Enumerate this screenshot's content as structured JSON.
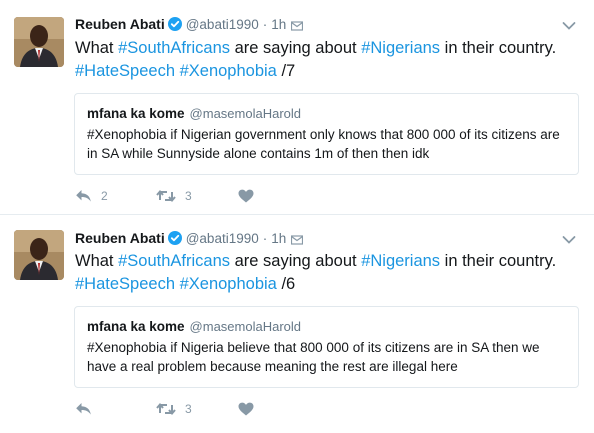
{
  "tweets": [
    {
      "author_name": "Reuben Abati",
      "handle": "@abati1990",
      "separator": "·",
      "time": "1h",
      "text_parts": [
        {
          "text": "What ",
          "hashtag": false
        },
        {
          "text": "#SouthAfricans",
          "hashtag": true
        },
        {
          "text": " are saying about ",
          "hashtag": false
        },
        {
          "text": "#Nigerians",
          "hashtag": true
        },
        {
          "text": " in their country. ",
          "hashtag": false
        },
        {
          "text": "#HateSpeech",
          "hashtag": true
        },
        {
          "text": " ",
          "hashtag": false
        },
        {
          "text": "#Xenophobia",
          "hashtag": true
        },
        {
          "text": " /7",
          "hashtag": false
        }
      ],
      "quote": {
        "author_name": "mfana ka kome",
        "handle": "@masemolaHarold",
        "text": "#Xenophobia if Nigerian government only knows that 800 000 of its citizens are in SA while Sunnyside alone contains 1m of then then idk"
      },
      "actions": {
        "reply_count": "2",
        "retweet_count": "3",
        "like_count": ""
      }
    },
    {
      "author_name": "Reuben Abati",
      "handle": "@abati1990",
      "separator": "·",
      "time": "1h",
      "text_parts": [
        {
          "text": "What ",
          "hashtag": false
        },
        {
          "text": "#SouthAfricans",
          "hashtag": true
        },
        {
          "text": " are saying about ",
          "hashtag": false
        },
        {
          "text": "#Nigerians",
          "hashtag": true
        },
        {
          "text": " in their country. ",
          "hashtag": false
        },
        {
          "text": "#HateSpeech",
          "hashtag": true
        },
        {
          "text": " ",
          "hashtag": false
        },
        {
          "text": "#Xenophobia",
          "hashtag": true
        },
        {
          "text": " /6",
          "hashtag": false
        }
      ],
      "quote": {
        "author_name": "mfana ka kome",
        "handle": "@masemolaHarold",
        "text": "#Xenophobia if Nigeria believe that 800 000 of its citizens are in SA then we have a real problem because meaning the rest are illegal here"
      },
      "actions": {
        "reply_count": "",
        "retweet_count": "3",
        "like_count": ""
      }
    }
  ],
  "colors": {
    "hashtag": "#1b95e0",
    "verified": "#1da1f2",
    "muted": "#657786",
    "action_icon": "#8899a6"
  },
  "icons": {
    "verified": "verified-badge-icon",
    "message": "direct-message-icon",
    "caret": "chevron-down-icon",
    "reply": "reply-icon",
    "retweet": "retweet-icon",
    "like": "heart-icon"
  }
}
